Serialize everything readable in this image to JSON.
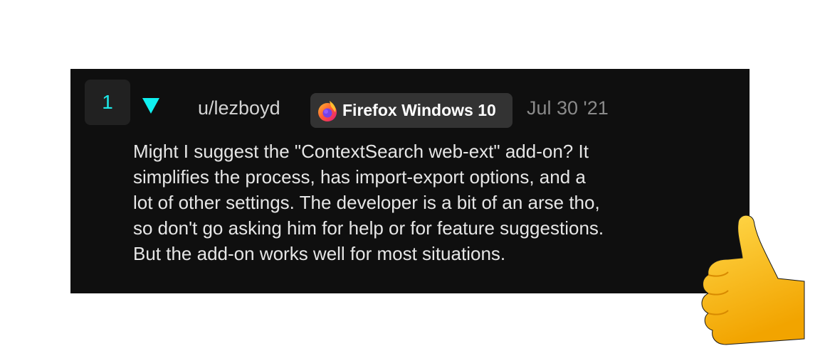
{
  "comment": {
    "score": "1",
    "username": "u/lezboyd",
    "flair": "Firefox Windows 10",
    "date": "Jul 30 '21",
    "body_lines": [
      "Might I suggest the \"ContextSearch web-ext\" add-on? It",
      "simplifies the process, has import-export options, and a",
      "lot of other settings. The developer is a bit of an arse tho,",
      "so don't go asking him for help or for feature suggestions.",
      "But the add-on works well for most situations."
    ]
  },
  "colors": {
    "accent": "#10f0f0",
    "panel": "#0f0f0f",
    "badge": "#333333"
  },
  "icons": {
    "downvote": "triangle-down-icon",
    "flair": "firefox-icon",
    "emoji": "thumbs-up-icon"
  }
}
